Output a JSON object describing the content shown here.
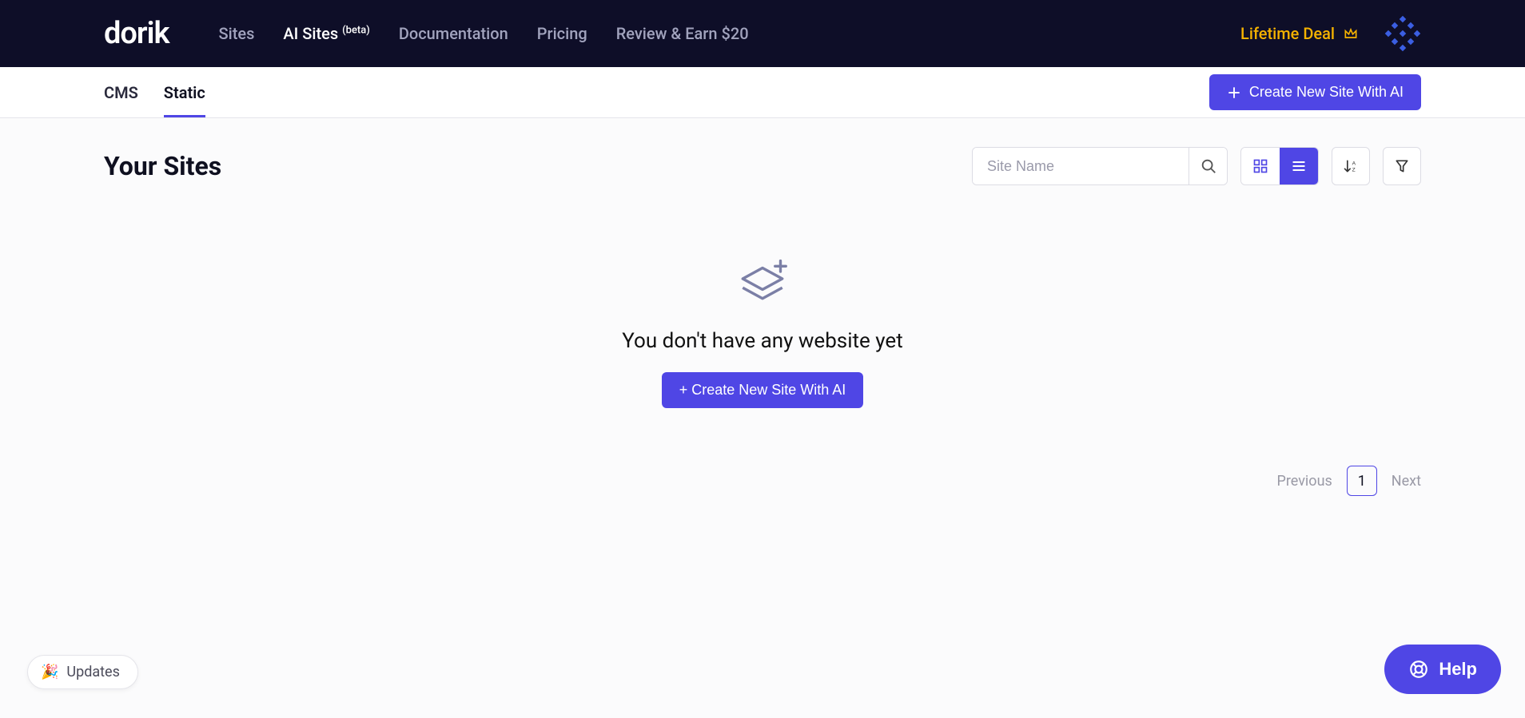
{
  "brand": "dorik",
  "nav": {
    "sites": "Sites",
    "ai_sites": "AI Sites",
    "ai_sites_badge": "(beta)",
    "documentation": "Documentation",
    "pricing": "Pricing",
    "review_earn": "Review & Earn $20",
    "lifetime": "Lifetime Deal"
  },
  "tabs": {
    "cms": "CMS",
    "static": "Static"
  },
  "create_button": "Create New Site With AI",
  "page_title": "Your Sites",
  "search_placeholder": "Site Name",
  "empty": {
    "message": "You don't have any website yet",
    "cta": "+ Create New Site With AI"
  },
  "pagination": {
    "prev": "Previous",
    "page": "1",
    "next": "Next"
  },
  "updates_label": "Updates",
  "help_label": "Help"
}
